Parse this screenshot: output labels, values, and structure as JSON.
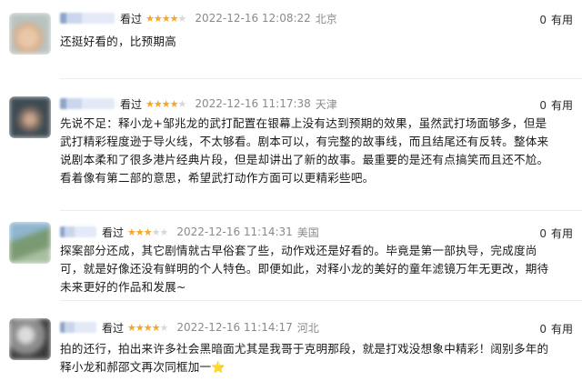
{
  "reviews": [
    {
      "watched": "看过",
      "stars": 4,
      "time": "2022-12-16 12:08:22",
      "location": "北京",
      "useful_count": "0",
      "useful_label": "有用",
      "text": "还挺好看的，比预期高"
    },
    {
      "watched": "看过",
      "stars": 4,
      "time": "2022-12-16 11:17:38",
      "location": "天津",
      "useful_count": "0",
      "useful_label": "有用",
      "text": "先说不足：释小龙+邹兆龙的武打配置在银幕上没有达到预期的效果，虽然武打场面够多，但是武打精彩程度逊于导火线，不太够看。剧本可以，有完整的故事线，而且结尾还有反转。整体来说剧本柔和了很多港片经典片段，但是却讲出了新的故事。最重要的是还有点搞笑而且还不尬。看着像有第二部的意思，希望武打动作方面可以更精彩些吧。"
    },
    {
      "watched": "看过",
      "stars": 3,
      "time": "2022-12-16 11:14:31",
      "location": "美国",
      "useful_count": "0",
      "useful_label": "有用",
      "text": "探案部分还成，其它剧情就古早俗套了些，动作戏还是好看的。毕竟是第一部执导，完成度尚可，就是好像还没有鲜明的个人特色。即便如此，对释小龙的美好的童年滤镜万年无更改，期待未来更好的作品和发展~"
    },
    {
      "watched": "看过",
      "stars": 4,
      "time": "2022-12-16 11:14:17",
      "location": "河北",
      "useful_count": "0",
      "useful_label": "有用",
      "text": "拍的还行，拍出来许多社会黑暗面尤其是我哥于克明那段，就是打戏没想象中精彩！阔别多年的释小龙和郝邵文再次同框加一⭐️"
    }
  ]
}
